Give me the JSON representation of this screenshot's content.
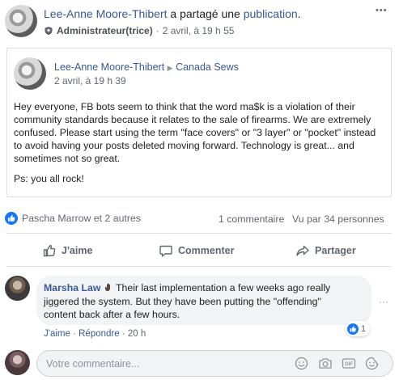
{
  "header": {
    "author": "Lee-Anne Moore-Thibert",
    "shared_text": " a partagé une ",
    "shared_link": "publication",
    "shared_end": ".",
    "role": "Administrateur(trice)",
    "separator": "·",
    "date": "2 avril, à 19 h 55",
    "more": "•••"
  },
  "shared_post": {
    "author": "Lee-Anne Moore-Thibert",
    "arrow": "▶",
    "group": "Canada Sews",
    "date": "2 avril, à 19 h 39",
    "body_line1": "Hey everyone, FB bots seem to think that the word ma$k is a violation of their",
    "body_line2": "community standards because it relates to the sale of firearms. We are extremely",
    "body_line3": "confused. Please start using the term \"face covers\" or \"3 layer\" or \"pocket\" instead",
    "body_line4": "to avoid having your posts deleted moving forward. Technology is great... and",
    "body_line5": "sometimes not so great.",
    "ps": "Ps: you all rock!"
  },
  "stats": {
    "reactors": "Pascha Marrow et 2 autres",
    "comments": "1 commentaire",
    "views": "Vu par 34 personnes"
  },
  "actions": {
    "like": "J'aime",
    "comment": "Commenter",
    "share": "Partager"
  },
  "comment": {
    "author": "Marsha Law",
    "text_line1": "Their last implementation a few weeks ago really",
    "text_line2": "jiggered the system. But they have been putting the \"offending\"",
    "text_line3": "content back after a few hours.",
    "like": "J'aime",
    "dot": "·",
    "reply": "Répondre",
    "time": "20 h",
    "reaction_count": "1",
    "more": "···"
  },
  "composer": {
    "placeholder": "Votre commentaire..."
  },
  "colors": {
    "link": "#385898",
    "like_blue": "#1877f2",
    "muted": "#606770",
    "divider": "#dadde1"
  }
}
